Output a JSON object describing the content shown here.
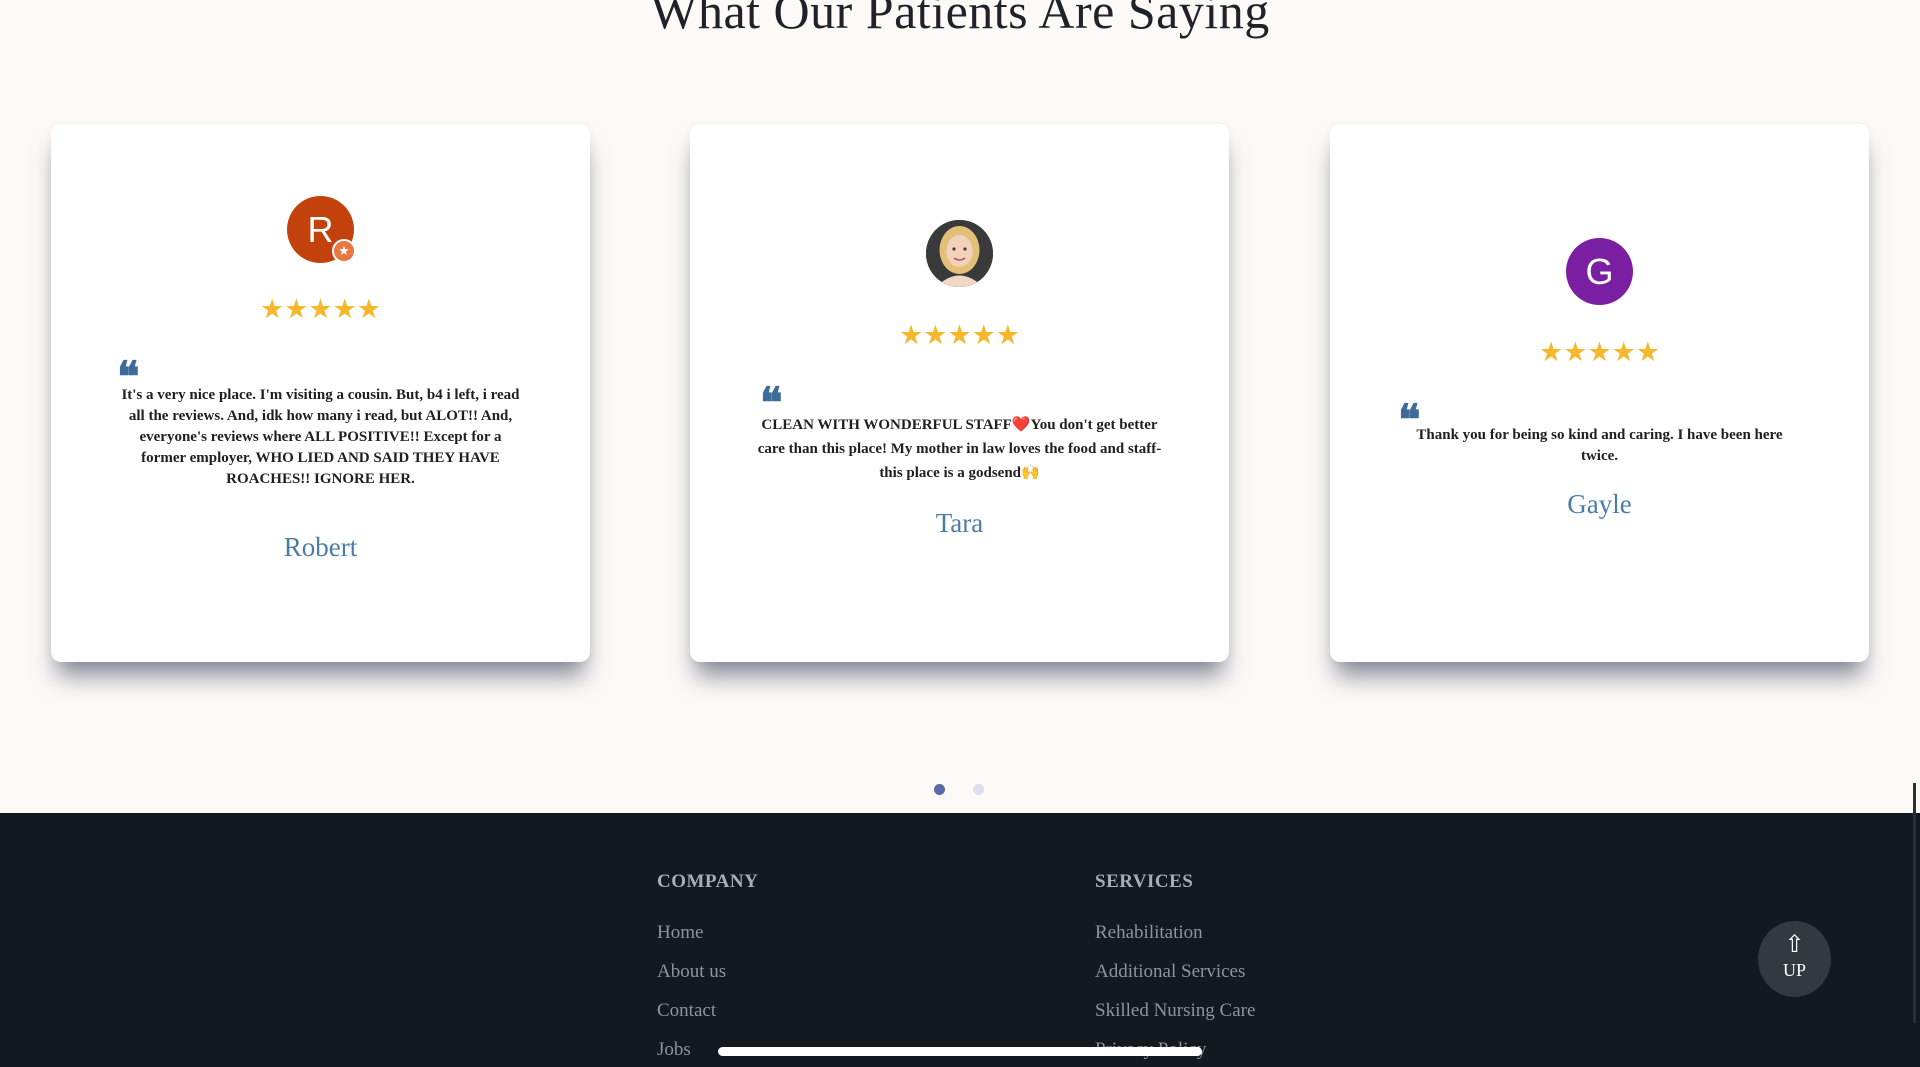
{
  "section": {
    "title": "What Our Patients Are Saying"
  },
  "reviews": [
    {
      "avatar_letter": "R",
      "avatar_color": "#c2410c",
      "stars": "★★★★★",
      "rating": 5,
      "quote_mark": "❝",
      "text": "It's a very nice place. I'm visiting a cousin. But, b4 i left, i read all the reviews. And, idk how many i read, but ALOT!! And, everyone's reviews where ALL POSITIVE!! Except for a former employer, WHO LIED AND SAID THEY HAVE ROACHES!! IGNORE HER.",
      "name": "Robert"
    },
    {
      "avatar_letter": "",
      "avatar_color": "#d9c19a",
      "stars": "★★★★★",
      "rating": 5,
      "quote_mark": "❝",
      "text": "CLEAN WITH WONDERFUL STAFF❤️You don't get better care than this place! My mother in law loves the food and staff-this place is a godsend🙌",
      "name": "Tara"
    },
    {
      "avatar_letter": "G",
      "avatar_color": "#7b1fa2",
      "stars": "★★★★★",
      "rating": 5,
      "quote_mark": "❝",
      "text": "Thank you for being so kind and caring. I have been here twice.",
      "name": "Gayle"
    }
  ],
  "carousel": {
    "pages": 2,
    "active_page": 1,
    "active_color": "#5a6aa8",
    "inactive_color": "#dcdff0"
  },
  "footer": {
    "company": {
      "title": "COMPANY",
      "links": [
        "Home",
        "About us",
        "Contact",
        "Jobs"
      ]
    },
    "services": {
      "title": "SERVICES",
      "links": [
        "Rehabilitation",
        "Additional Services",
        "Skilled Nursing Care",
        "Privacy Policy"
      ]
    },
    "up_button": {
      "icon": "up-arrow-icon",
      "label": "UP"
    }
  }
}
